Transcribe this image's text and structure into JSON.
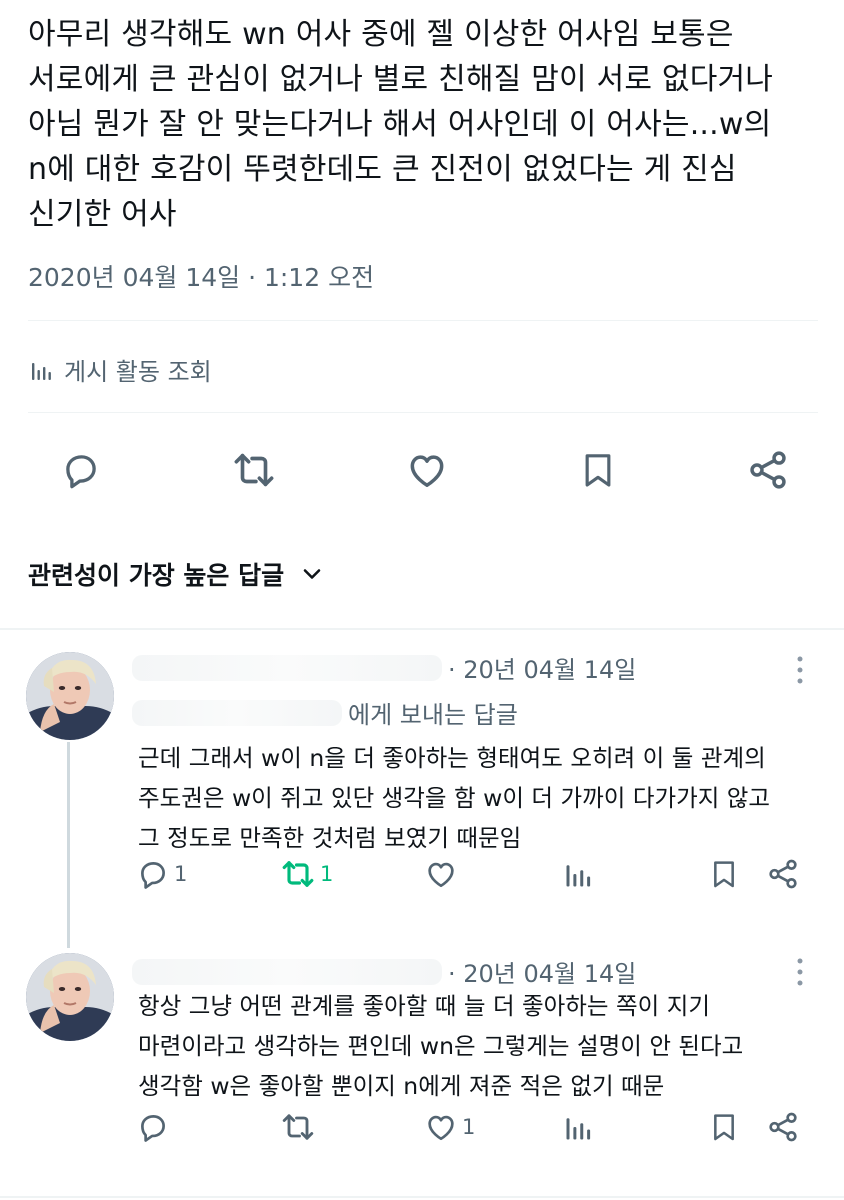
{
  "main_post": {
    "lines": [
      "아무리 생각해도 wn 어사 중에 젤 이상한 어사임 보통은",
      "서로에게 큰 관심이 없거나 별로 친해질 맘이 서로 없다거나",
      "아님 뭔가 잘 안 맞는다거나 해서 어사인데 이 어사는...w의",
      "n에 대한 호감이 뚜렷한데도 큰 진전이 없었다는 게 진심",
      "신기한 어사"
    ],
    "timestamp": "2020년 04월 14일 · 1:12 오전",
    "analytics_label": "게시 활동 조회"
  },
  "sort": {
    "label": "관련성이 가장 높은 답글"
  },
  "replies": [
    {
      "date": "· 20년 04월 14일",
      "reply_to_suffix": "에게 보내는 답글",
      "lines": [
        "근데 그래서 w이 n을 더 좋아하는 형태여도 오히려 이 둘 관계의",
        "주도권은 w이 쥐고 있단 생각을 함 w이 더 가까이 다가가지 않고",
        "그 정도로 만족한 것처럼 보였기 때문임"
      ],
      "reply_count": "1",
      "repost_count": "1",
      "like_count": "",
      "reposted": true
    },
    {
      "date": "· 20년 04월 14일",
      "lines": [
        "항상 그냥 어떤 관계를 좋아할 때 늘 더 좋아하는 쪽이 지기",
        "마련이라고 생각하는 편인데 wn은 그렇게는 설명이 안 된다고",
        "생각함 w은 좋아할 뿐이지 n에게 져준 적은 없기 때문"
      ],
      "reply_count": "",
      "repost_count": "",
      "like_count": "1",
      "reposted": false
    }
  ],
  "colors": {
    "text": "#0f1419",
    "secondary": "#536471",
    "repost_active": "#00ba7c",
    "divider": "#eff3f4"
  },
  "icons": [
    "reply-icon",
    "repost-icon",
    "like-icon",
    "bookmark-icon",
    "share-icon",
    "analytics-icon",
    "chevron-down-icon",
    "more-icon"
  ]
}
